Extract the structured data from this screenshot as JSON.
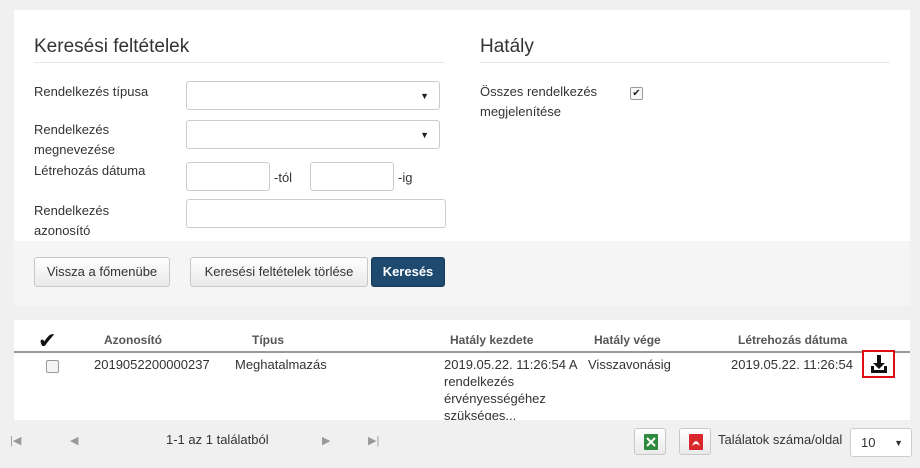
{
  "search": {
    "title": "Keresési feltételek",
    "type_label": "Rendelkezés típusa",
    "name_label": "Rendelkezés megnevezése",
    "date_label": "Létrehozás dátuma",
    "from_suffix": "-tól",
    "to_suffix": "-ig",
    "id_label": "Rendelkezés azonosító"
  },
  "scope": {
    "title": "Hatály",
    "show_all_label": "Összes rendelkezés megjelenítése",
    "show_all_checked": true
  },
  "buttons": {
    "back": "Vissza a főmenübe",
    "clear": "Keresési feltételek törlése",
    "search": "Keresés"
  },
  "table": {
    "columns": {
      "id": "Azonosító",
      "type": "Típus",
      "start": "Hatály kezdete",
      "end": "Hatály vége",
      "created": "Létrehozás dátuma"
    },
    "rows": [
      {
        "id": "2019052200000237",
        "type": "Meghatalmazás",
        "start": "2019.05.22. 11:26:54 A rendelkezés érvényességéhez szükséges...",
        "end": "Visszavonásig",
        "created": "2019.05.22. 11:26:54"
      }
    ]
  },
  "pager": {
    "summary": "1-1 az 1 találatból",
    "page_size_label": "Találatok száma/oldal",
    "page_size": "10"
  },
  "colors": {
    "primary": "#1e4a70",
    "highlight": "#dd1111",
    "excel": "#2e8b3d",
    "pdf": "#d9262b"
  },
  "icons": [
    "check-all-icon",
    "download-icon",
    "excel-icon",
    "pdf-icon",
    "first-page-icon",
    "prev-page-icon",
    "next-page-icon",
    "last-page-icon",
    "dropdown-caret-icon"
  ]
}
